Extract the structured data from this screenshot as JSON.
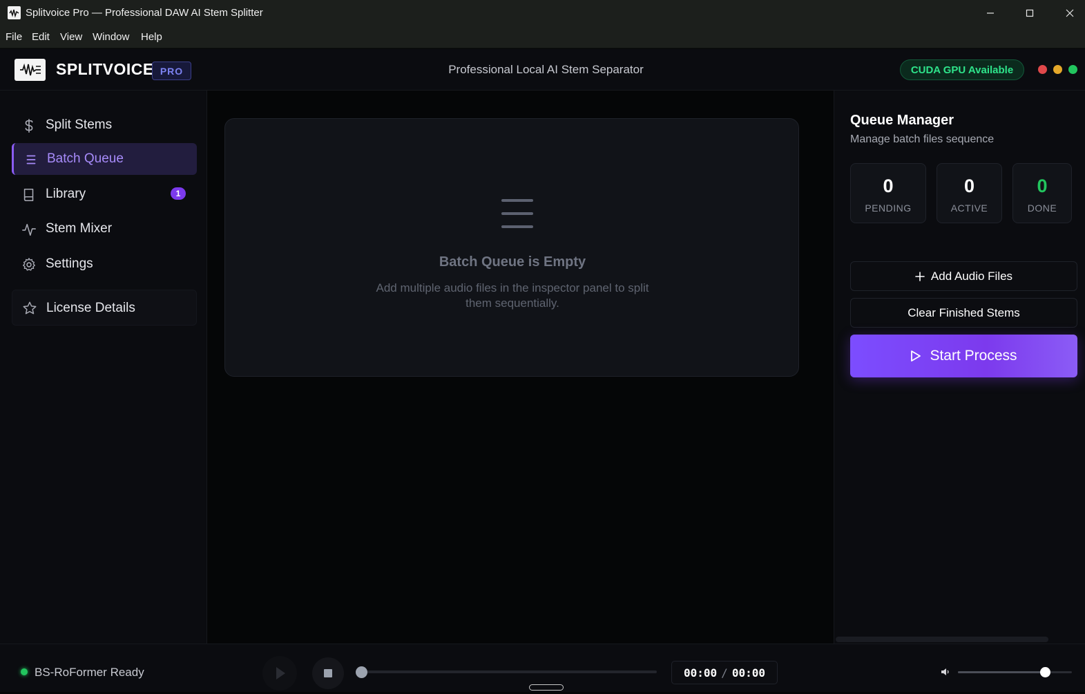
{
  "window": {
    "title": "Splitvoice Pro — Professional DAW AI Stem Splitter",
    "minimize": "—",
    "maximize": "☐",
    "close": "✕"
  },
  "menu": [
    "File",
    "Edit",
    "View",
    "Window",
    "Help"
  ],
  "header": {
    "brand": "SPLITVOICE",
    "badge": "PRO",
    "subtitle": "Professional Local AI Stem Separator",
    "gpu_status": "CUDA GPU Available",
    "traffic_lights": [
      "#e0484a",
      "#e5a82a",
      "#22c55e"
    ]
  },
  "sidebar": {
    "items": [
      {
        "label": "Split Stems",
        "icon": "dollar-icon"
      },
      {
        "label": "Batch Queue",
        "icon": "list-icon",
        "active": true
      },
      {
        "label": "Library",
        "icon": "book-icon",
        "badge": "1"
      },
      {
        "label": "Stem Mixer",
        "icon": "activity-icon"
      },
      {
        "label": "Settings",
        "icon": "gear-icon"
      }
    ],
    "license": {
      "label": "License Details",
      "icon": "star-icon"
    }
  },
  "main": {
    "empty_title": "Batch Queue is Empty",
    "empty_desc": "Add multiple audio files in the inspector panel to split them sequentially."
  },
  "queue": {
    "title": "Queue Manager",
    "subtitle": "Manage batch files sequence",
    "stats": [
      {
        "value": "0",
        "label": "PENDING"
      },
      {
        "value": "0",
        "label": "ACTIVE"
      },
      {
        "value": "0",
        "label": "DONE"
      }
    ],
    "add_button": "Add Audio Files",
    "clear_button": "Clear Finished Stems",
    "start_button": "Start Process"
  },
  "player": {
    "status": "BS-RoFormer Ready",
    "current_time": "00:00",
    "separator": "/",
    "total_time": "00:00",
    "progress": 0,
    "volume": 0.78
  },
  "colors": {
    "accent": "#8b5cf6",
    "success": "#22c55e",
    "background": "#060708"
  }
}
